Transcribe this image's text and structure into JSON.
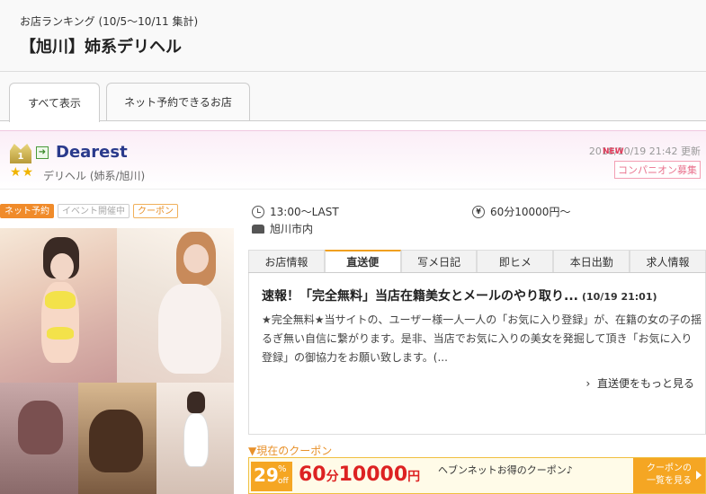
{
  "header": {
    "ranking_label": "お店ランキング (10/5〜10/11 集計)",
    "title": "【旭川】姉系デリヘル"
  },
  "main_tabs": [
    {
      "label": "すべて表示"
    },
    {
      "label": "ネット予約できるお店"
    }
  ],
  "shop": {
    "rank": "1",
    "name": "Dearest",
    "stars": "★★",
    "category": "デリヘル (姉系/旭川)",
    "updated": "2018/10/19 21:42 更新",
    "new_mark": "NEW",
    "companion": "コンパニオン募集",
    "badges": {
      "net": "ネット予約",
      "event": "イベント開催中",
      "coupon": "クーポン"
    },
    "hours": "13:00〜LAST",
    "price": "60分10000円〜",
    "area": "旭川市内"
  },
  "sub_tabs": [
    {
      "label": "お店情報"
    },
    {
      "label": "直送便"
    },
    {
      "label": "写メ日記"
    },
    {
      "label": "即ヒメ"
    },
    {
      "label": "本日出勤"
    },
    {
      "label": "求人情報"
    }
  ],
  "post": {
    "title": "速報！「完全無料」当店在籍美女とメールのやり取り...",
    "date": "(10/19 21:01)",
    "body": "★完全無料★当サイトの、ユーザー様一人一人の「お気に入り登録」が、在籍の女の子の揺るぎ無い自信に繋がります。是非、当店でお気に入りの美女を発掘して頂き「お気に入り登録」の御協力をお願い致します。(...",
    "more_link": "直送便をもっと見る"
  },
  "coupon": {
    "section_label": "▼現在のクーポン",
    "percent": "29",
    "percent_sign": "%",
    "off": "off",
    "price_minutes": "60",
    "price_unit1": "分",
    "price_amount": "10000",
    "price_unit2": "円",
    "desc": "ヘブンネットお得のクーポン♪",
    "button_line1": "クーポンの",
    "button_line2": "一覧を見る"
  }
}
